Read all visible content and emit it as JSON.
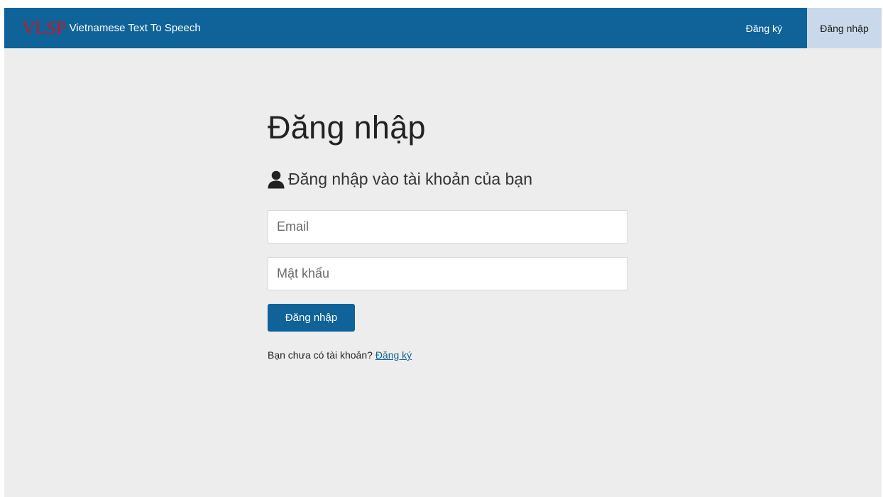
{
  "navbar": {
    "logo_text": "VLSP",
    "app_title": "Vietnamese Text To Speech",
    "register_link": "Đăng ký",
    "login_link": "Đăng nhập"
  },
  "login": {
    "title": "Đăng nhập",
    "subtitle_icon": "user-icon",
    "subtitle": "Đăng nhập vào tài khoản của bạn",
    "email_placeholder": "Email",
    "password_placeholder": "Mật khẩu",
    "submit_label": "Đăng nhập",
    "no_account_text": "Bạn chưa có tài khoản? ",
    "register_link": "Đăng ký"
  },
  "colors": {
    "navbar_bg": "#0f6399",
    "active_tab_bg": "#c9d9eb",
    "logo": "#c01a2c",
    "page_bg": "#ededed"
  }
}
